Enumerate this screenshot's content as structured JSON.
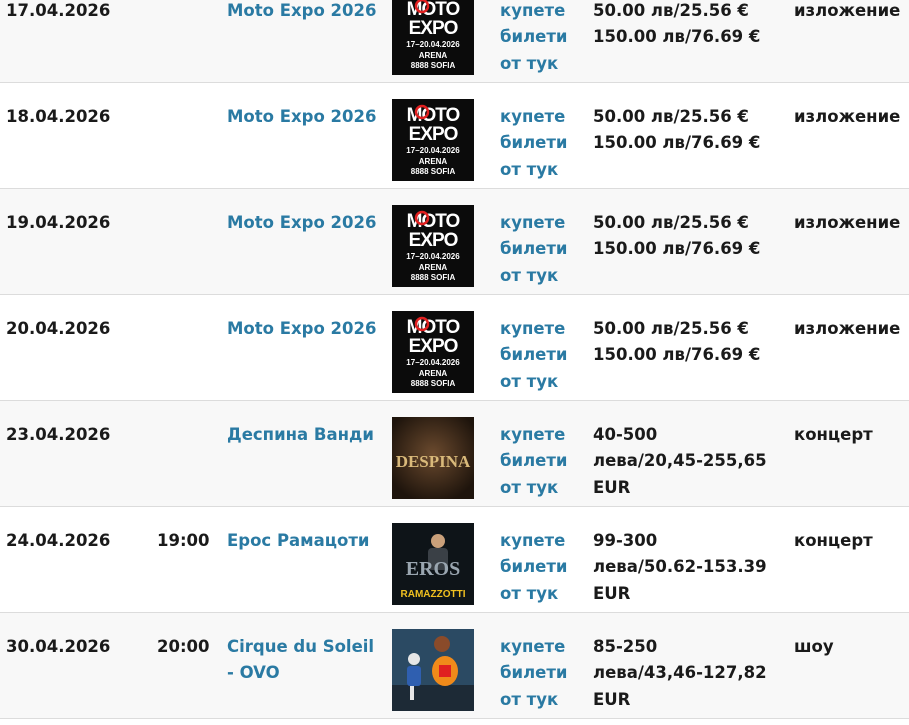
{
  "events": [
    {
      "date": "17.04.2026",
      "time": "",
      "title": "Moto Expo 2026",
      "poster": "moto-expo",
      "buy_lines": [
        "купете",
        "билети",
        "от тук"
      ],
      "price_lines": [
        "50.00 лв/25.56 €",
        "150.00 лв/76.69 €"
      ],
      "type": "изложение"
    },
    {
      "date": "18.04.2026",
      "time": "",
      "title": "Moto Expo 2026",
      "poster": "moto-expo",
      "buy_lines": [
        "купете",
        "билети",
        "от тук"
      ],
      "price_lines": [
        "50.00 лв/25.56 €",
        "150.00 лв/76.69 €"
      ],
      "type": "изложение"
    },
    {
      "date": "19.04.2026",
      "time": "",
      "title": "Moto Expo 2026",
      "poster": "moto-expo",
      "buy_lines": [
        "купете",
        "билети",
        "от тук"
      ],
      "price_lines": [
        "50.00 лв/25.56 €",
        "150.00 лв/76.69 €"
      ],
      "type": "изложение"
    },
    {
      "date": "20.04.2026",
      "time": "",
      "title": "Moto Expo 2026",
      "poster": "moto-expo",
      "buy_lines": [
        "купете",
        "билети",
        "от тук"
      ],
      "price_lines": [
        "50.00 лв/25.56 €",
        "150.00 лв/76.69 €"
      ],
      "type": "изложение"
    },
    {
      "date": "23.04.2026",
      "time": "",
      "title": "Деспина Ванди",
      "poster": "despina",
      "buy_lines": [
        "купете",
        "билети",
        "от тук"
      ],
      "price_lines": [
        "40-500",
        "лева/20,45-255,65",
        "EUR"
      ],
      "type": "концерт"
    },
    {
      "date": "24.04.2026",
      "time": "19:00",
      "title": "Ерос Рамацоти",
      "poster": "eros",
      "buy_lines": [
        "купете",
        "билети",
        "от тук"
      ],
      "price_lines": [
        "99-300",
        "лева/50.62-153.39",
        "EUR"
      ],
      "type": "концерт"
    },
    {
      "date": "30.04.2026",
      "time": "20:00",
      "title": "Cirque du Soleil - OVO",
      "poster": "ovo",
      "buy_lines": [
        "купете",
        "билети",
        "от тук"
      ],
      "price_lines": [
        "85-250",
        "лева/43,46-127,82",
        "EUR"
      ],
      "type": "шоу"
    }
  ],
  "posters": {
    "moto-expo": {
      "line1": "MOTO",
      "line2": "EXPO",
      "line3": "17–20.04.2026",
      "line4": "ARENA",
      "line5": "8888 SOFIA"
    },
    "despina": {
      "text": "DESPINA"
    },
    "eros": {
      "line1": "EROS",
      "line2": "RAMAZZOTTI"
    },
    "ovo": {}
  }
}
